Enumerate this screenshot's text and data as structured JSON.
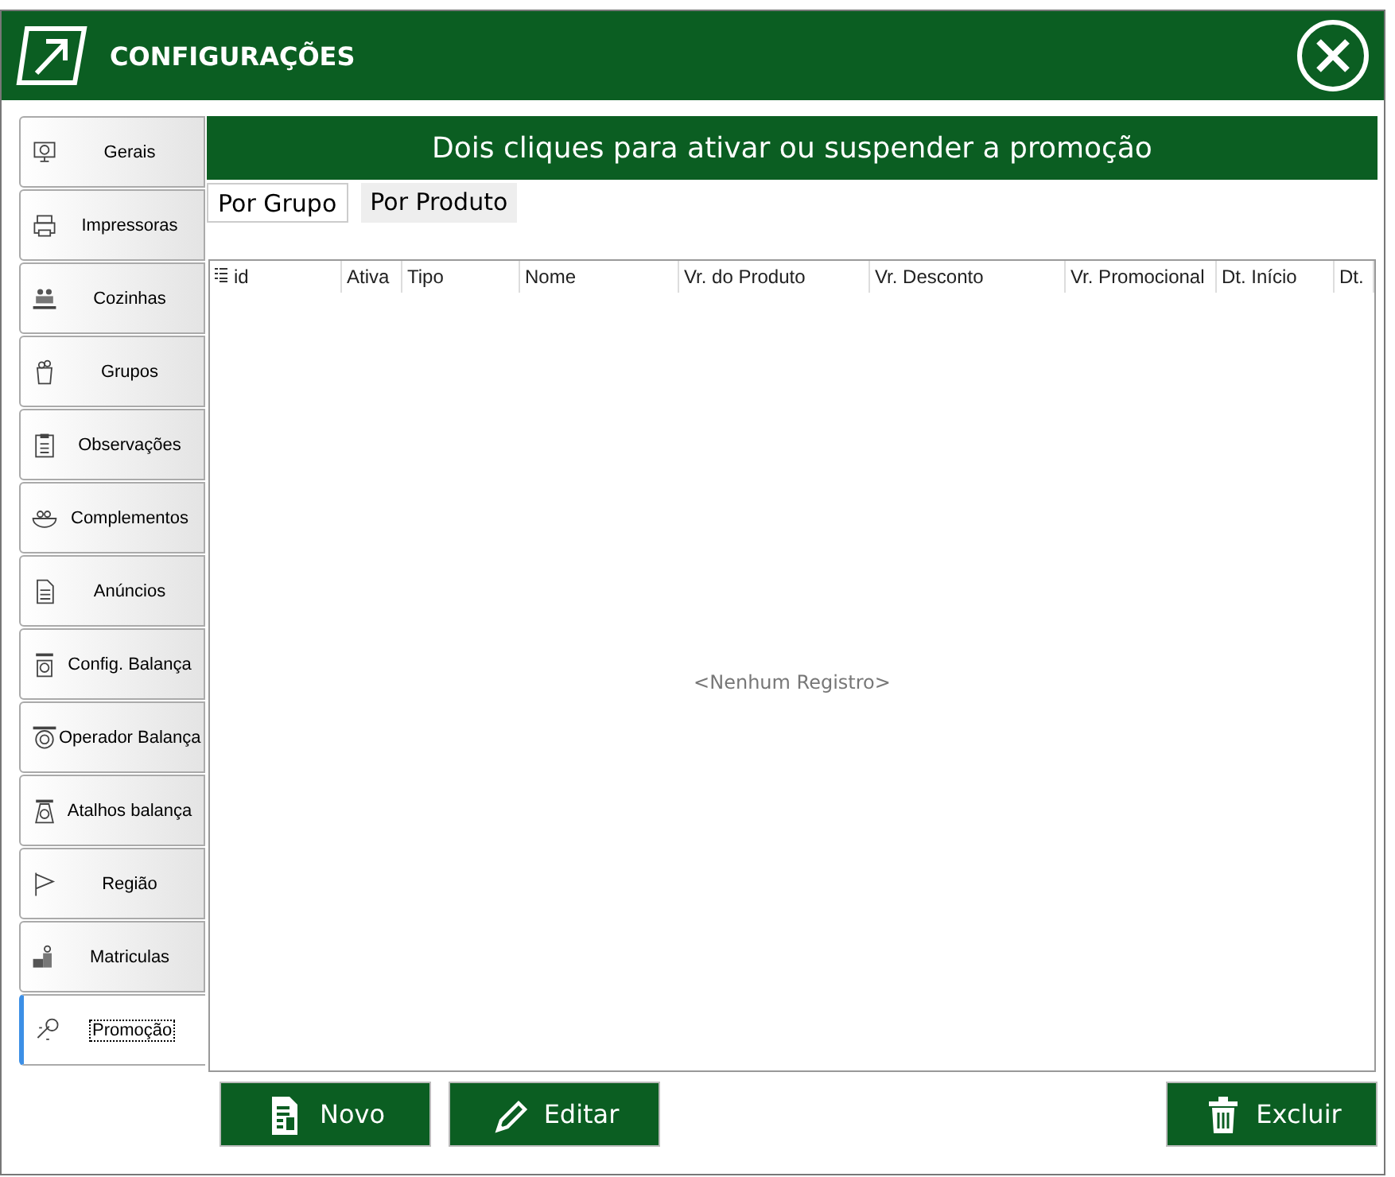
{
  "window": {
    "title": "CONFIGURAÇÕES"
  },
  "sidebar": {
    "items": [
      {
        "label": "Gerais",
        "selected": false
      },
      {
        "label": "Impressoras",
        "selected": false
      },
      {
        "label": "Cozinhas",
        "selected": false
      },
      {
        "label": "Grupos",
        "selected": false
      },
      {
        "label": "Observações",
        "selected": false
      },
      {
        "label": "Complementos",
        "selected": false
      },
      {
        "label": "Anúncios",
        "selected": false
      },
      {
        "label": "Config. Balança",
        "selected": false
      },
      {
        "label": "Operador  Balança",
        "selected": false
      },
      {
        "label": "Atalhos balança",
        "selected": false
      },
      {
        "label": "Região",
        "selected": false
      },
      {
        "label": "Matriculas",
        "selected": false
      },
      {
        "label": "Promoção",
        "selected": true
      }
    ]
  },
  "banner": "Dois cliques para ativar ou suspender a promoção",
  "tabs": [
    {
      "label": "Por Grupo",
      "selected": true
    },
    {
      "label": "Por Produto",
      "selected": false
    }
  ],
  "table": {
    "columns": [
      "id",
      "Ativa",
      "Tipo",
      "Nome",
      "Vr. do Produto",
      "Vr. Desconto",
      "Vr. Promocional",
      "Dt. Início",
      "Dt."
    ],
    "empty_text": "<Nenhum Registro>"
  },
  "buttons": [
    {
      "label": "Novo",
      "kind": "new"
    },
    {
      "label": "Editar",
      "kind": "edit"
    },
    {
      "label": "Excluir",
      "kind": "delete"
    }
  ]
}
